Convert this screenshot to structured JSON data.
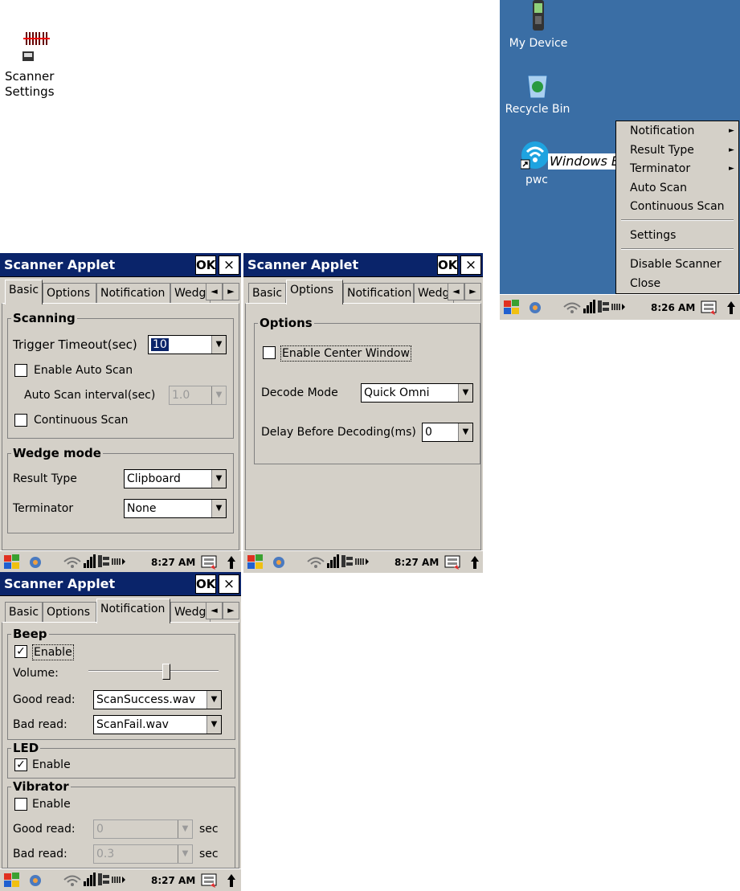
{
  "shortcut": {
    "label1": "Scanner",
    "label2": "Settings"
  },
  "applet": {
    "title": "Scanner Applet",
    "ok": "OK",
    "close": "×"
  },
  "tabs": [
    "Basic",
    "Options",
    "Notification",
    "Wedg"
  ],
  "tab_arrows": {
    "left": "◄",
    "right": "►"
  },
  "combo_arrow": "▼",
  "taskbar": {
    "time1": "8:27 AM",
    "time2": "8:27 AM",
    "time3": "8:27 AM",
    "time_desktop": "8:26 AM"
  },
  "basic": {
    "scanning_title": "Scanning",
    "trigger_label": "Trigger Timeout(sec)",
    "trigger_value": "10",
    "auto_scan_label": "Enable Auto Scan",
    "auto_scan_checked": false,
    "interval_label": "Auto Scan interval(sec)",
    "interval_value": "1.0",
    "continuous_label": "Continuous Scan",
    "continuous_checked": false,
    "wedge_title": "Wedge mode",
    "result_type_label": "Result Type",
    "result_type_value": "Clipboard",
    "terminator_label": "Terminator",
    "terminator_value": "None"
  },
  "options": {
    "group_title": "Options",
    "center_window_label": "Enable Center Window",
    "center_window_checked": false,
    "decode_mode_label": "Decode Mode",
    "decode_mode_value": "Quick Omni",
    "delay_label": "Delay Before Decoding(ms)",
    "delay_value": "0"
  },
  "notification": {
    "beep_title": "Beep",
    "beep_enable_label": "Enable",
    "beep_enabled": true,
    "volume_label": "Volume:",
    "volume_level": 0.6,
    "good_read_label": "Good read:",
    "good_read_value": "ScanSuccess.wav",
    "bad_read_label": "Bad read:",
    "bad_read_value": "ScanFail.wav",
    "led_title": "LED",
    "led_enable_label": "Enable",
    "led_enabled": true,
    "vibrator_title": "Vibrator",
    "vib_enable_label": "Enable",
    "vib_enabled": false,
    "vib_good_label": "Good read:",
    "vib_good_value": "0",
    "vib_bad_label": "Bad read:",
    "vib_bad_value": "0.3",
    "unit": "sec"
  },
  "desktop": {
    "my_device": "My Device",
    "recycle_bin": "Recycle Bin",
    "ie_label": "Windows E",
    "pwc": "pwc",
    "menu": [
      "Notification",
      "Result Type",
      "Terminator",
      "Auto Scan",
      "Continuous Scan",
      "Settings",
      "Disable Scanner",
      "Close"
    ]
  },
  "colors": {
    "titlebar": "#0a246a",
    "desktop": "#3a6ea5",
    "face": "#d4d0c8"
  },
  "icons": [
    "barcode-icon",
    "start-flag-icon",
    "sync-icon",
    "wifi-icon",
    "signal-icon",
    "battery-icon",
    "keyboard-icon",
    "up-arrow-icon"
  ]
}
